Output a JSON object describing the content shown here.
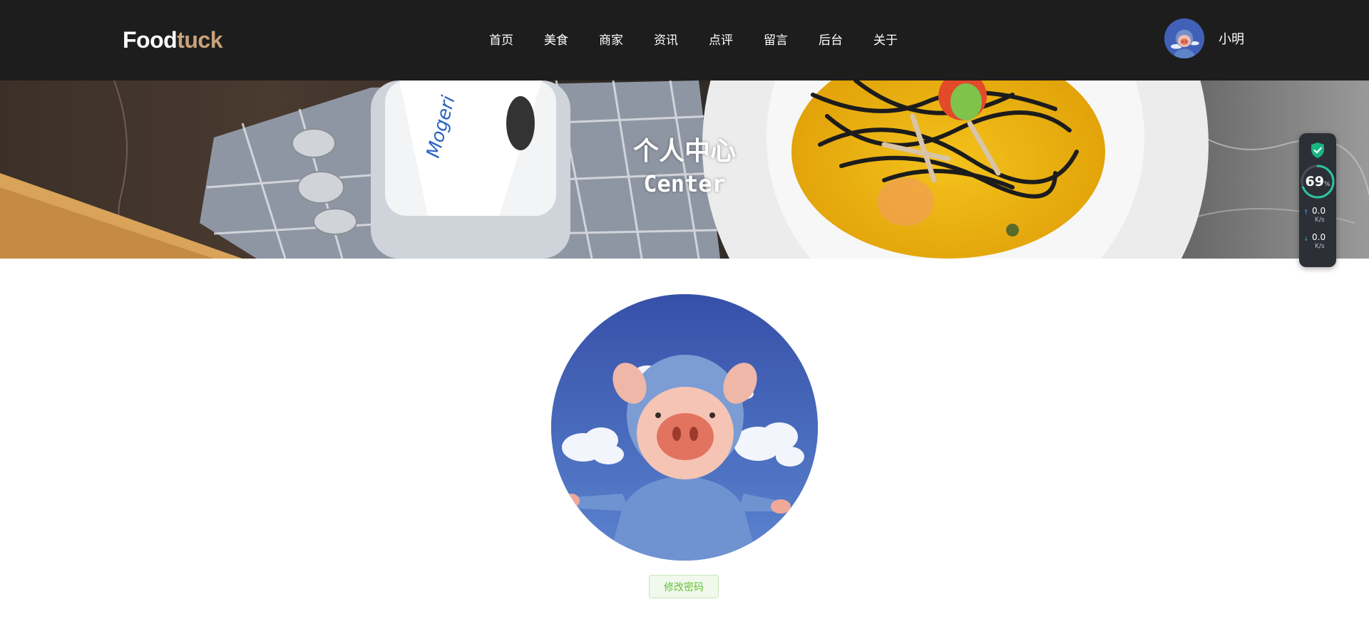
{
  "header": {
    "logo": {
      "part1": "Food",
      "part2": "tuck"
    },
    "nav": [
      "首页",
      "美食",
      "商家",
      "资讯",
      "点评",
      "留言",
      "后台",
      "关于"
    ],
    "user": {
      "name": "小明",
      "avatar_icon": "pig-avatar"
    }
  },
  "banner": {
    "title": "个人中心",
    "subtitle": "Center"
  },
  "widget": {
    "shield_icon": "shield-check-icon",
    "percent": "69",
    "percent_unit": "%",
    "usage_fraction": 0.69,
    "upload": {
      "value": "0.0",
      "unit": "K/s"
    },
    "download": {
      "value": "0.0",
      "unit": "K/s"
    }
  },
  "profile": {
    "avatar_icon": "pig-avatar",
    "change_password_label": "修改密码"
  },
  "colors": {
    "header_bg": "#1d1d1d",
    "logo_accent": "#c8a27a",
    "button_green": "#67c23a",
    "avatar_sky": "#3d5fb5"
  }
}
